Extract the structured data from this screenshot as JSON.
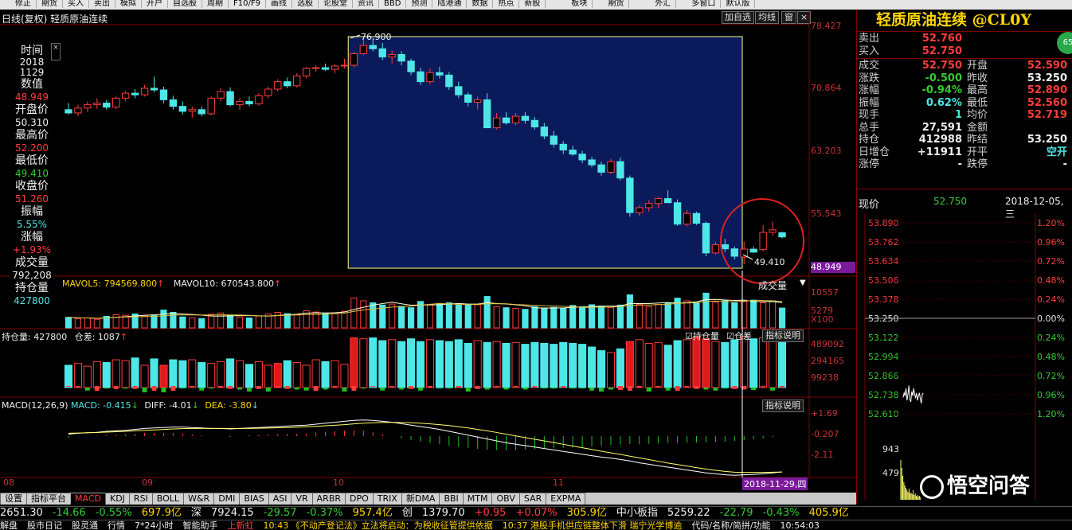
{
  "menu": [
    "",
    "修正",
    "期货",
    "买入",
    "卖出",
    "模拟",
    "开户",
    "自选股",
    "周期",
    "F10/F9",
    "画线",
    "选股",
    "论股堂",
    "资讯",
    "BBD",
    "预测",
    "陆港通",
    "数据",
    "热点",
    "新股",
    "",
    "",
    "板块",
    "",
    "期货",
    "",
    "",
    "外汇",
    "",
    "多窗口",
    "默认版"
  ],
  "chart_header": {
    "title": "日线(复权)  轻质原油连续",
    "btn_add": "加自选",
    "btn_ma": "均线",
    "btn_win": "窗"
  },
  "instrument": {
    "name": "轻质原油连续 @CL0Y"
  },
  "left_panel": {
    "time_label": "时间",
    "year": "2018",
    "date": "1129",
    "value_label": "数值",
    "value": "48.949",
    "open_label": "开盘价",
    "open": "50.310",
    "high_label": "最高价",
    "high": "52.200",
    "low_label": "最低价",
    "low": "49.410",
    "close_label": "收盘价",
    "close": "51.260",
    "amp_label": "振幅",
    "amp": "5.55%",
    "chg_label": "涨幅",
    "chg": "+1.93%",
    "vol_label": "成交量",
    "vol": "792,208",
    "oi_label": "持仓量",
    "oi": "427800"
  },
  "price_axis": [
    "78.427",
    "70.864",
    "63.203",
    "55.543",
    "48.949"
  ],
  "price_annotations": {
    "high": "76.900",
    "low": "49.410"
  },
  "volume_panel": {
    "ma5": "MAVOL5: 794569.800",
    "ma10": "MAVOL10: 670543.800",
    "selector": "成交量",
    "axis": [
      "10557",
      "5279",
      "X100"
    ]
  },
  "oi_panel": {
    "label": "持仓量: 427800",
    "diff": "仓差: 1087",
    "chk_oi": "持仓量",
    "chk_diff": "仓差",
    "help": "指标说明",
    "axis": [
      "489092",
      "294165",
      "99238"
    ]
  },
  "macd_panel": {
    "label": "MACD(12,26,9)",
    "macd": "MACD: -0.415",
    "diffv": "DIFF: -4.01",
    "dea": "DEA: -3.80",
    "help": "指标说明",
    "axis": [
      "+1.69",
      "-0.207",
      "-2.11"
    ]
  },
  "months": [
    "08",
    "09",
    "10",
    "11"
  ],
  "cursor_date": "2018-11-29,四",
  "tabs": [
    "设置",
    "指标平台",
    "MACD",
    "KDJ",
    "RSI",
    "BOLL",
    "W&R",
    "DMI",
    "BIAS",
    "ASI",
    "VR",
    "ARBR",
    "DPO",
    "TRIX",
    "新DMA",
    "BBI",
    "MTM",
    "OBV",
    "SAR",
    "EXPMA"
  ],
  "quote": {
    "rows": [
      {
        "l": "卖出",
        "v": "52.760",
        "c": "red"
      },
      {
        "l": "买入",
        "v": "52.750",
        "c": "red"
      }
    ],
    "stats": [
      {
        "l1": "成交",
        "v1": "52.750",
        "c1": "red",
        "l2": "开盘",
        "v2": "52.590",
        "c2": "red"
      },
      {
        "l1": "涨跌",
        "v1": "-0.500",
        "c1": "green",
        "l2": "昨收",
        "v2": "53.250",
        "c2": "white"
      },
      {
        "l1": "涨幅",
        "v1": "-0.94%",
        "c1": "green",
        "l2": "最高",
        "v2": "52.890",
        "c2": "red"
      },
      {
        "l1": "振幅",
        "v1": "0.62%",
        "c1": "cyan",
        "l2": "最低",
        "v2": "52.560",
        "c2": "red"
      },
      {
        "l1": "现手",
        "v1": "1",
        "c1": "cyan",
        "l2": "均价",
        "v2": "52.719",
        "c2": "red"
      },
      {
        "l1": "总手",
        "v1": "27,591",
        "c1": "white",
        "l2": "金额",
        "v2": "",
        "c2": "white"
      },
      {
        "l1": "持仓",
        "v1": "412988",
        "c1": "white",
        "l2": "昨结",
        "v2": "53.250",
        "c2": "white"
      },
      {
        "l1": "日增仓",
        "v1": "+11911",
        "c1": "white",
        "l2": "开平",
        "v2": "空开",
        "c2": "cyan"
      },
      {
        "l1": "涨停",
        "v1": "-",
        "c1": "white",
        "l2": "跌停",
        "v2": "-",
        "c2": "white"
      }
    ]
  },
  "intraday": {
    "label": "现价",
    "price": "52.750",
    "date": "2018-12-05,三",
    "left_axis": [
      "53.890",
      "53.762",
      "53.634",
      "53.506",
      "53.378",
      "53.250",
      "53.122",
      "52.994",
      "52.866",
      "52.738",
      "52.610"
    ],
    "right_axis": [
      "1.20%",
      "0.96%",
      "0.72%",
      "0.48%",
      "0.24%",
      "0.00%",
      "0.24%",
      "0.48%",
      "0.72%",
      "0.96%",
      "1.20%"
    ],
    "vol_axis": [
      "943",
      "479"
    ]
  },
  "ticker1": [
    {
      "t": "2651.30",
      "c": "white"
    },
    {
      "t": "-14.66",
      "c": "green"
    },
    {
      "t": "-0.55%",
      "c": "green"
    },
    {
      "t": "697.9亿",
      "c": "yellow"
    },
    {
      "t": "深",
      "c": "white"
    },
    {
      "t": "7924.15",
      "c": "white"
    },
    {
      "t": "-29.57",
      "c": "green"
    },
    {
      "t": "-0.37%",
      "c": "green"
    },
    {
      "t": "957.4亿",
      "c": "yellow"
    },
    {
      "t": "创",
      "c": "white"
    },
    {
      "t": "1379.70",
      "c": "white"
    },
    {
      "t": "+0.95",
      "c": "red"
    },
    {
      "t": "+0.07%",
      "c": "red"
    },
    {
      "t": "305.9亿",
      "c": "yellow"
    },
    {
      "t": "中小板指",
      "c": "white"
    },
    {
      "t": "5259.22",
      "c": "white"
    },
    {
      "t": "-22.79",
      "c": "green"
    },
    {
      "t": "-0.43%",
      "c": "green"
    },
    {
      "t": "405.9亿",
      "c": "yellow"
    }
  ],
  "ticker2": [
    {
      "t": "解盘",
      "c": "white"
    },
    {
      "t": "股市日记",
      "c": "white"
    },
    {
      "t": "股灵通",
      "c": "white"
    },
    {
      "t": "行情",
      "c": "white"
    },
    {
      "t": "7*24小时",
      "c": "white"
    },
    {
      "t": "智能助手",
      "c": "white"
    },
    {
      "t": "上新虹",
      "c": "red"
    },
    {
      "t": "10:43 《不动产登记法》立法将启动：为税收征管提供依据",
      "c": "yellow"
    },
    {
      "t": "10:37 港股手机供应链整体下滑 瑞宁光学博逾",
      "c": "yellow"
    },
    {
      "t": "代码/名称/简拼/功能",
      "c": "white"
    },
    {
      "t": "10:54:03",
      "c": "white"
    }
  ],
  "watermark": "悟空问答",
  "chart_data": [
    {
      "type": "candlestick",
      "title": "轻质原油连续 日线",
      "x_months": [
        "08",
        "09",
        "10",
        "11"
      ],
      "ylim": [
        48.949,
        78.427
      ],
      "ohlc": [
        [
          68.2,
          69.0,
          67.6,
          67.8
        ],
        [
          67.8,
          68.8,
          67.4,
          68.4
        ],
        [
          68.4,
          69.2,
          67.9,
          68.8
        ],
        [
          68.8,
          69.6,
          68.3,
          69.0
        ],
        [
          69.0,
          69.4,
          68.2,
          68.5
        ],
        [
          68.5,
          69.8,
          68.3,
          69.6
        ],
        [
          69.6,
          70.5,
          69.2,
          70.2
        ],
        [
          70.2,
          70.7,
          69.6,
          70.0
        ],
        [
          70.0,
          71.2,
          69.8,
          70.8
        ],
        [
          70.8,
          72.2,
          70.3,
          70.6
        ],
        [
          70.6,
          71.0,
          69.0,
          69.4
        ],
        [
          69.4,
          69.9,
          68.2,
          68.6
        ],
        [
          68.6,
          69.2,
          67.6,
          68.0
        ],
        [
          68.0,
          68.6,
          67.2,
          68.2
        ],
        [
          68.2,
          68.6,
          67.4,
          67.7
        ],
        [
          67.7,
          69.8,
          67.5,
          69.6
        ],
        [
          69.6,
          70.8,
          69.2,
          70.4
        ],
        [
          70.4,
          70.9,
          68.6,
          68.8
        ],
        [
          68.8,
          69.6,
          68.2,
          69.2
        ],
        [
          69.2,
          69.8,
          68.6,
          68.9
        ],
        [
          68.9,
          70.2,
          68.7,
          69.9
        ],
        [
          69.9,
          71.0,
          69.6,
          70.7
        ],
        [
          70.7,
          71.9,
          70.4,
          71.6
        ],
        [
          71.6,
          72.1,
          70.8,
          71.1
        ],
        [
          71.1,
          72.6,
          70.9,
          72.3
        ],
        [
          72.3,
          73.4,
          72.0,
          73.2
        ],
        [
          73.2,
          73.6,
          72.8,
          73.3
        ],
        [
          73.3,
          73.8,
          72.9,
          73.1
        ],
        [
          73.1,
          73.7,
          72.6,
          73.5
        ],
        [
          73.5,
          74.4,
          73.2,
          73.6
        ],
        [
          73.6,
          75.2,
          73.3,
          75.0
        ],
        [
          75.0,
          76.9,
          74.8,
          76.0
        ],
        [
          76.0,
          76.9,
          75.3,
          75.6
        ],
        [
          75.6,
          76.3,
          74.2,
          74.6
        ],
        [
          74.6,
          75.4,
          73.8,
          74.9
        ],
        [
          74.9,
          75.3,
          73.6,
          74.1
        ],
        [
          74.1,
          74.4,
          72.4,
          72.8
        ],
        [
          72.8,
          73.3,
          71.2,
          71.6
        ],
        [
          71.6,
          73.2,
          71.3,
          72.7
        ],
        [
          72.7,
          73.4,
          72.0,
          72.4
        ],
        [
          72.4,
          72.8,
          70.6,
          71.0
        ],
        [
          71.0,
          71.6,
          69.6,
          70.0
        ],
        [
          70.0,
          70.3,
          68.6,
          69.1
        ],
        [
          69.1,
          69.8,
          68.2,
          69.4
        ],
        [
          69.4,
          70.2,
          67.2,
          66.0
        ],
        [
          66.0,
          67.8,
          65.8,
          67.2
        ],
        [
          67.2,
          67.9,
          66.4,
          66.6
        ],
        [
          66.6,
          67.8,
          66.3,
          67.4
        ],
        [
          67.4,
          67.9,
          66.5,
          66.9
        ],
        [
          66.9,
          67.3,
          65.8,
          66.1
        ],
        [
          66.1,
          66.6,
          64.6,
          65.0
        ],
        [
          65.0,
          65.6,
          63.6,
          64.0
        ],
        [
          64.0,
          64.4,
          62.8,
          63.3
        ],
        [
          63.3,
          63.8,
          62.6,
          62.8
        ],
        [
          62.8,
          63.2,
          61.7,
          62.1
        ],
        [
          62.1,
          62.5,
          61.2,
          61.5
        ],
        [
          61.5,
          61.9,
          60.2,
          60.6
        ],
        [
          60.6,
          62.2,
          60.4,
          61.9
        ],
        [
          61.9,
          62.4,
          59.6,
          59.9
        ],
        [
          59.9,
          60.2,
          55.2,
          55.7
        ],
        [
          55.7,
          56.6,
          55.3,
          56.3
        ],
        [
          56.3,
          57.2,
          55.8,
          56.8
        ],
        [
          56.8,
          57.6,
          56.2,
          57.4
        ],
        [
          57.4,
          58.4,
          56.9,
          56.9
        ],
        [
          56.9,
          57.3,
          54.1,
          54.3
        ],
        [
          54.3,
          56.0,
          54.0,
          55.6
        ],
        [
          55.6,
          55.8,
          54.2,
          54.4
        ],
        [
          54.4,
          54.6,
          50.4,
          50.8
        ],
        [
          50.8,
          52.2,
          50.6,
          51.8
        ],
        [
          51.8,
          52.5,
          50.9,
          51.3
        ],
        [
          51.3,
          51.6,
          50.0,
          50.4
        ],
        [
          50.3,
          52.2,
          49.41,
          51.26
        ],
        [
          51.26,
          51.6,
          50.8,
          50.9
        ],
        [
          51.2,
          54.2,
          51.0,
          53.3
        ],
        [
          53.3,
          54.6,
          52.9,
          53.6
        ],
        [
          53.25,
          53.4,
          52.56,
          52.75
        ]
      ],
      "highlight_range_start": 30
    },
    {
      "type": "bar",
      "title": "成交量",
      "values": [
        320,
        280,
        300,
        260,
        350,
        400,
        380,
        420,
        360,
        390,
        540,
        470,
        330,
        300,
        280,
        410,
        450,
        380,
        330,
        300,
        360,
        420,
        470,
        430,
        390,
        520,
        480,
        440,
        460,
        500,
        900,
        820,
        760,
        690,
        720,
        650,
        610,
        800,
        700,
        740,
        760,
        690,
        710,
        700,
        950,
        640,
        610,
        590,
        560,
        640,
        600,
        620,
        590,
        680,
        640,
        700,
        660,
        620,
        690,
        1000,
        720,
        640,
        710,
        760,
        900,
        820,
        750,
        1050,
        780,
        820,
        760,
        792,
        840,
        760,
        820,
        600
      ]
    },
    {
      "type": "bar",
      "title": "持仓量",
      "values": [
        2700,
        2800,
        2650,
        2900,
        2850,
        3000,
        2950,
        3100,
        2700,
        3050,
        2700,
        3000,
        2950,
        3000,
        2850,
        2800,
        2900,
        3050,
        2950,
        2750,
        2900,
        2700,
        2800,
        2950,
        2850,
        2700,
        3000,
        2900,
        2950,
        2750,
        4200,
        4150,
        4200,
        4050,
        4100,
        4000,
        4150,
        4000,
        4100,
        4050,
        4000,
        4100,
        3900,
        4050,
        3950,
        4000,
        3900,
        3950,
        3850,
        3950,
        3900,
        3850,
        3950,
        3900,
        3850,
        3700,
        3500,
        3400,
        3600,
        4000,
        4100,
        3900,
        3950,
        3800,
        4050,
        4100,
        4250,
        4150,
        4000,
        3950,
        4100,
        4278,
        4150,
        4200,
        4050,
        4130
      ]
    },
    {
      "type": "line",
      "title": "MACD(12,26,9)",
      "series": [
        {
          "name": "DIFF",
          "values": [
            0.2,
            0.3,
            0.35,
            0.4,
            0.5,
            0.55,
            0.6,
            0.7,
            0.8,
            0.85,
            0.9,
            0.95,
            0.95,
            0.9,
            0.85,
            0.8,
            0.8,
            0.75,
            0.8,
            0.85,
            0.9,
            0.95,
            1.0,
            1.05,
            1.1,
            1.15,
            1.25,
            1.35,
            1.45,
            1.55,
            1.65,
            1.69,
            1.65,
            1.55,
            1.45,
            1.3,
            1.15,
            1.0,
            0.85,
            0.7,
            0.5,
            0.3,
            0.1,
            -0.1,
            -0.3,
            -0.5,
            -0.7,
            -0.85,
            -1.0,
            -1.15,
            -1.3,
            -1.45,
            -1.6,
            -1.75,
            -1.9,
            -2.05,
            -2.2,
            -2.3,
            -2.45,
            -2.6,
            -2.8,
            -2.95,
            -3.1,
            -3.25,
            -3.4,
            -3.55,
            -3.7,
            -3.85,
            -3.95,
            -4.05,
            -4.1,
            -4.05,
            -4.01,
            -3.95,
            -3.85,
            -3.75
          ]
        },
        {
          "name": "DEA",
          "values": [
            0.3,
            0.32,
            0.35,
            0.38,
            0.42,
            0.46,
            0.5,
            0.55,
            0.6,
            0.65,
            0.7,
            0.75,
            0.78,
            0.8,
            0.8,
            0.8,
            0.8,
            0.8,
            0.8,
            0.8,
            0.82,
            0.84,
            0.87,
            0.9,
            0.94,
            0.98,
            1.02,
            1.08,
            1.14,
            1.2,
            1.28,
            1.35,
            1.4,
            1.43,
            1.44,
            1.43,
            1.4,
            1.35,
            1.28,
            1.2,
            1.1,
            0.98,
            0.85,
            0.7,
            0.55,
            0.38,
            0.2,
            0.02,
            -0.16,
            -0.33,
            -0.5,
            -0.68,
            -0.86,
            -1.04,
            -1.22,
            -1.4,
            -1.58,
            -1.75,
            -1.92,
            -2.1,
            -2.28,
            -2.46,
            -2.64,
            -2.82,
            -2.98,
            -3.14,
            -3.3,
            -3.45,
            -3.58,
            -3.7,
            -3.78,
            -3.8,
            -3.8,
            -3.8,
            -3.78,
            -3.76
          ]
        }
      ]
    },
    {
      "type": "line",
      "title": "分时",
      "ylim": [
        52.61,
        53.89
      ],
      "series": [
        {
          "values": [
            52.72,
            52.75,
            52.73,
            52.78,
            52.7,
            52.74,
            52.8,
            52.71,
            52.69,
            52.76,
            52.73,
            52.78,
            52.74,
            52.72,
            52.75,
            52.7,
            52.73,
            52.75,
            52.71,
            52.68,
            52.74,
            52.75
          ]
        }
      ]
    }
  ]
}
